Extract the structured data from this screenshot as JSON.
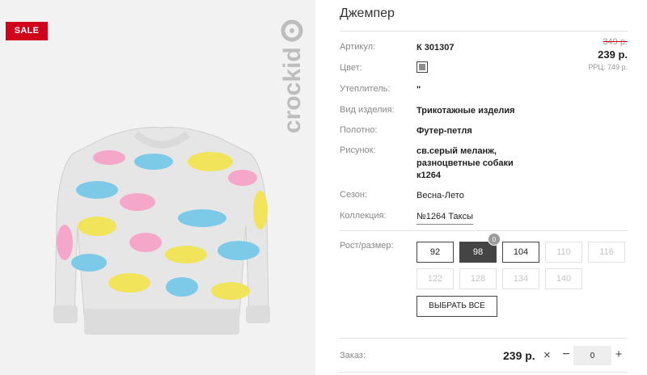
{
  "image": {
    "sale_badge": "SALE",
    "brand_logo": "crockid"
  },
  "product": {
    "title": "Джемпер",
    "attributes": [
      {
        "label": "Артикул:",
        "value": "К 301307"
      },
      {
        "label": "Цвет:",
        "value": ""
      },
      {
        "label": "Утеплитель:",
        "value": "\""
      },
      {
        "label": "Вид изделия:",
        "value": "Трикотажные изделия"
      },
      {
        "label": "Полотно:",
        "value": "Футер-петля"
      },
      {
        "label": "Рисунок:",
        "value_lines": [
          "св.серый меланж,",
          "разноцветные собаки",
          "к1264"
        ]
      },
      {
        "label": "Сезон:",
        "value": "Весна-Лето"
      },
      {
        "label": "Коллекция:",
        "value": "№1264 Таксы"
      }
    ],
    "color_swatch": "#8c8c8c"
  },
  "price": {
    "old": "349 р.",
    "new": "239 р.",
    "rrc": "РРЦ: 749 р."
  },
  "sizes": {
    "label": "Рост/размер:",
    "options": [
      {
        "label": "92",
        "state": "available"
      },
      {
        "label": "98",
        "state": "selected",
        "count": "0"
      },
      {
        "label": "104",
        "state": "available"
      },
      {
        "label": "110",
        "state": "disabled"
      },
      {
        "label": "116",
        "state": "disabled"
      },
      {
        "label": "122",
        "state": "disabled"
      },
      {
        "label": "128",
        "state": "disabled"
      },
      {
        "label": "134",
        "state": "disabled"
      },
      {
        "label": "140",
        "state": "disabled"
      }
    ],
    "select_all": "ВЫБРАТЬ ВСЕ"
  },
  "order": {
    "label": "Заказ:",
    "price": "239 р.",
    "times": "×",
    "minus": "−",
    "quantity": "0",
    "plus": "+"
  },
  "colors": {
    "sale": "#d0021b",
    "selected_size": "#444444"
  }
}
